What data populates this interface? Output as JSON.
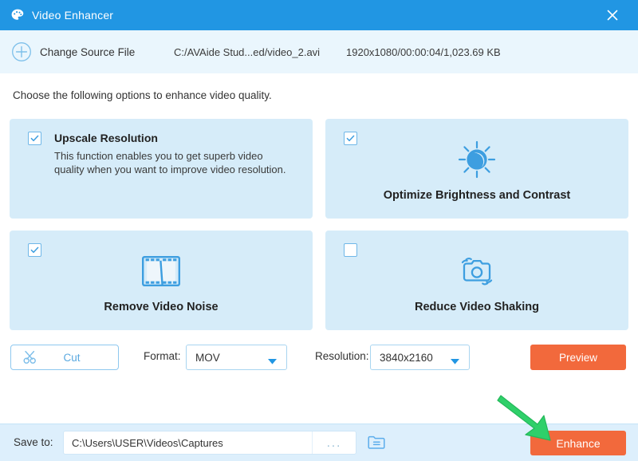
{
  "window": {
    "title": "Video Enhancer",
    "logo_icon": "palette-icon",
    "close_icon": "close-icon",
    "accent_color": "#2196e3",
    "action_color": "#f2693c"
  },
  "source_bar": {
    "add_icon": "circle-plus-icon",
    "change_source_label": "Change Source File",
    "file_path": "C:/AVAide Stud...ed/video_2.avi",
    "file_meta": "1920x1080/00:00:04/1,023.69 KB"
  },
  "main": {
    "intro": "Choose the following options to enhance video quality.",
    "options": [
      {
        "id": "upscale-resolution",
        "label": "Upscale Resolution",
        "description": "This function enables you to get superb video quality when you want to improve video resolution.",
        "checked": true,
        "layout": "text",
        "icon": ""
      },
      {
        "id": "optimize-brightness-contrast",
        "label": "Optimize Brightness and Contrast",
        "description": "",
        "checked": true,
        "layout": "icon",
        "icon": "brightness-sun-icon"
      },
      {
        "id": "remove-video-noise",
        "label": "Remove Video Noise",
        "description": "",
        "checked": true,
        "layout": "icon",
        "icon": "film-strip-icon"
      },
      {
        "id": "reduce-video-shaking",
        "label": "Reduce Video Shaking",
        "description": "",
        "checked": false,
        "layout": "icon",
        "icon": "camera-shake-icon"
      }
    ]
  },
  "controls": {
    "cut_label": "Cut",
    "cut_icon": "scissors-icon",
    "format_label": "Format:",
    "format_value": "MOV",
    "resolution_label": "Resolution:",
    "resolution_value": "3840x2160",
    "preview_label": "Preview",
    "caret_icon": "chevron-down-icon"
  },
  "footer": {
    "save_to_label": "Save to:",
    "save_path": "C:\\Users\\USER\\Videos\\Captures",
    "browse_label": "...",
    "folder_icon": "folder-icon",
    "enhance_label": "Enhance"
  },
  "annotation": {
    "arrow_icon": "green-arrow-icon",
    "arrow_color": "#2fd06a",
    "points_to": "Enhance"
  }
}
